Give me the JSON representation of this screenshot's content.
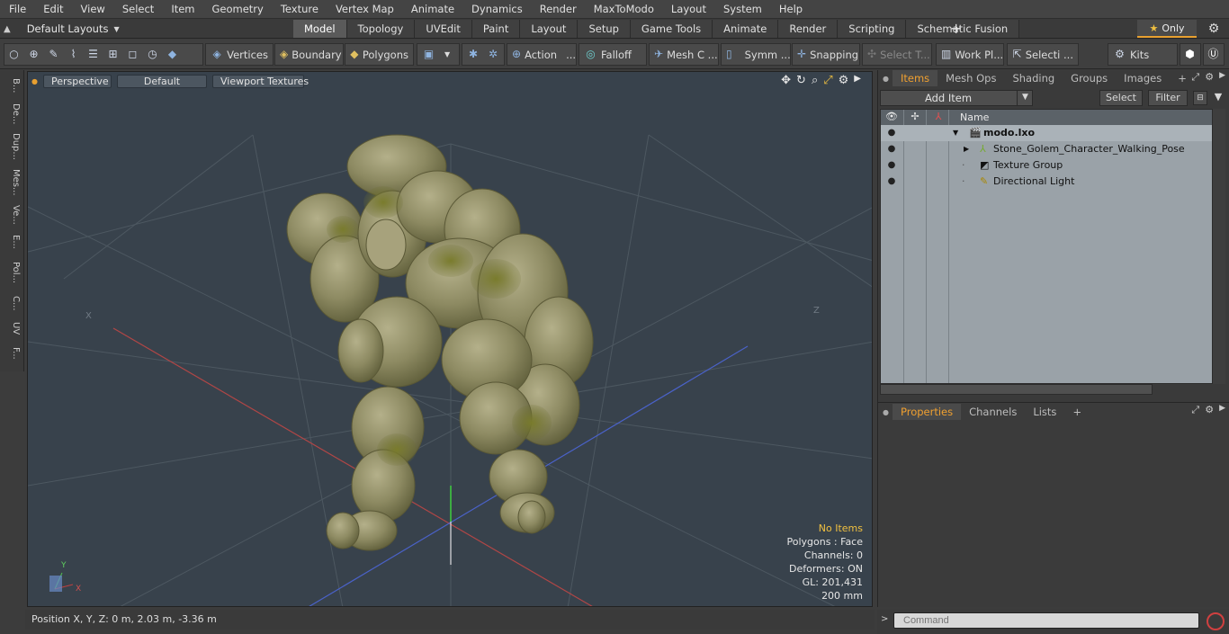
{
  "menu": [
    "File",
    "Edit",
    "View",
    "Select",
    "Item",
    "Geometry",
    "Texture",
    "Vertex Map",
    "Animate",
    "Dynamics",
    "Render",
    "MaxToModo",
    "Layout",
    "System",
    "Help"
  ],
  "layouts": {
    "label": "Default Layouts"
  },
  "tabs": [
    "Model",
    "Topology",
    "UVEdit",
    "Paint",
    "Layout",
    "Setup",
    "Game Tools",
    "Animate",
    "Render",
    "Scripting",
    "Schematic Fusion"
  ],
  "active_tab": "Model",
  "only_label": "Only",
  "toolbar": {
    "vertices": "Vertices",
    "boundary": "Boundary",
    "polygons": "Polygons",
    "action": "Action",
    "falloff": "Falloff",
    "mesh": "Mesh C ...",
    "symm": "Symm ...",
    "snapping": "Snapping",
    "select_t": "Select T...",
    "work_pl": "Work Pl...",
    "selecti": "Selecti ...",
    "kits": "Kits"
  },
  "left_tabs": [
    "B...",
    "De...",
    "Dup...",
    "Mes...",
    "Ve...",
    "E...",
    "Pol...",
    "C...",
    "UV",
    "F..."
  ],
  "viewport": {
    "perspective": "Perspective",
    "default": "Default",
    "textures": "Viewport Textures",
    "axis_x_label": "X",
    "axis_z_label": "Z",
    "gizmo_y": "Y",
    "gizmo_x": "X",
    "hud": {
      "no_items": "No Items",
      "polygons": "Polygons : Face",
      "channels": "Channels: 0",
      "deformers": "Deformers: ON",
      "gl": "GL: 201,431",
      "scale": "200 mm"
    }
  },
  "status": "Position X, Y, Z:   0 m, 2.03 m, -3.36 m",
  "items_panel": {
    "tabs": [
      "Items",
      "Mesh Ops",
      "Shading",
      "Groups",
      "Images"
    ],
    "add_item": "Add Item",
    "select": "Select",
    "filter": "Filter",
    "column_name": "Name",
    "rows": [
      {
        "label": "modo.lxo"
      },
      {
        "label": "Stone_Golem_Character_Walking_Pose"
      },
      {
        "label": "Texture Group"
      },
      {
        "label": "Directional Light"
      }
    ]
  },
  "props_panel": {
    "tabs": [
      "Properties",
      "Channels",
      "Lists"
    ]
  },
  "command": {
    "placeholder": "Command"
  }
}
